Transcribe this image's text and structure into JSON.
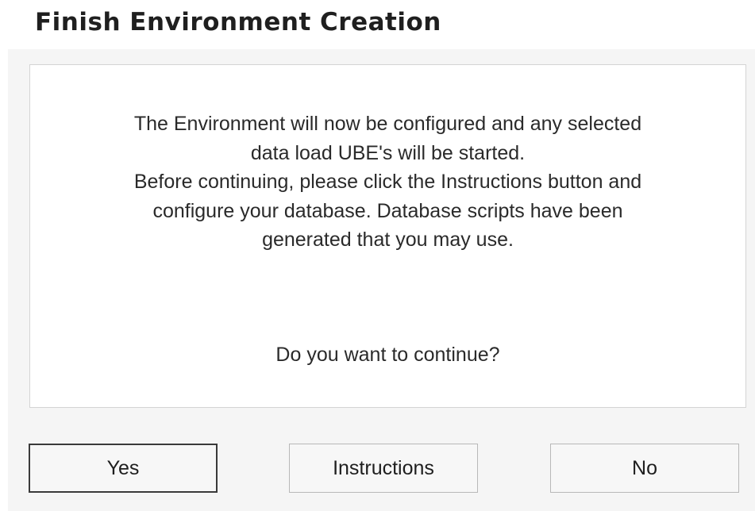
{
  "dialog": {
    "title": "Finish Environment Creation",
    "message_lines": [
      "The Environment will now be configured and any selected",
      "data load UBE's will be started.",
      "Before continuing, please click the Instructions button and",
      "configure your database. Database scripts have been",
      "generated that you may use."
    ],
    "question": "Do you want to continue?",
    "buttons": {
      "yes": "Yes",
      "instructions": "Instructions",
      "no": "No"
    },
    "default_button": "yes"
  }
}
